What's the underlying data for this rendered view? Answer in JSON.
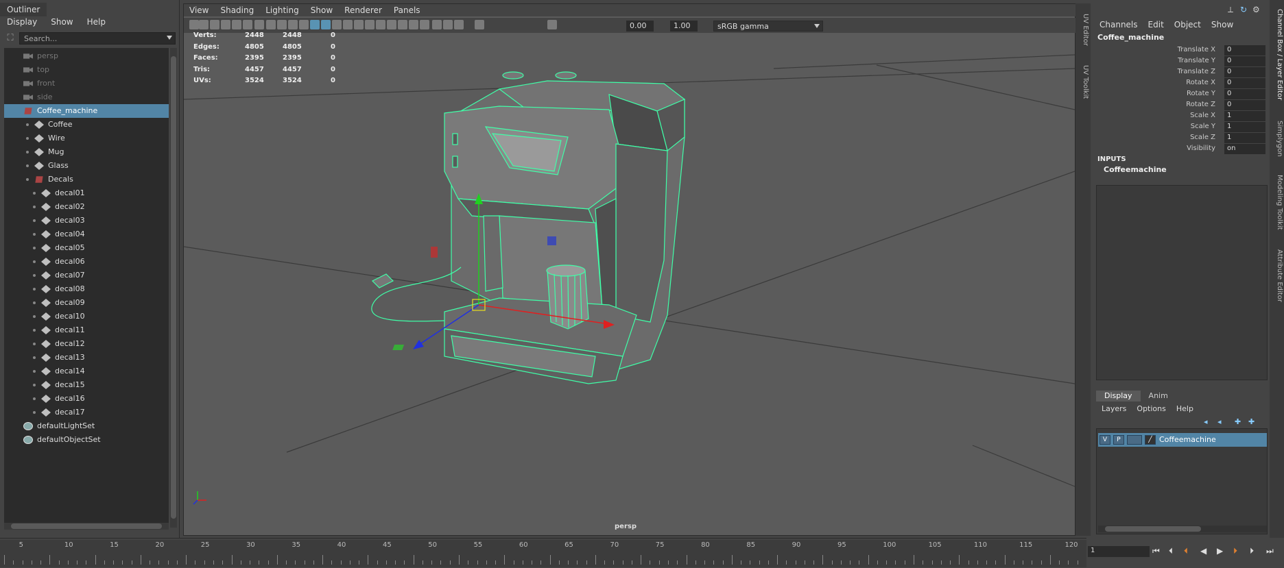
{
  "outliner": {
    "title": "Outliner",
    "menu": [
      "Display",
      "Show",
      "Help"
    ],
    "search_placeholder": "Search...",
    "items": [
      {
        "label": "persp",
        "kind": "camera",
        "dim": true
      },
      {
        "label": "top",
        "kind": "camera",
        "dim": true
      },
      {
        "label": "front",
        "kind": "camera",
        "dim": true
      },
      {
        "label": "side",
        "kind": "camera",
        "dim": true
      },
      {
        "label": "Coffee_machine",
        "kind": "transform",
        "selected": true
      },
      {
        "label": "Coffee",
        "kind": "mesh"
      },
      {
        "label": "Wire",
        "kind": "mesh"
      },
      {
        "label": "Mug",
        "kind": "mesh"
      },
      {
        "label": "Glass",
        "kind": "mesh"
      },
      {
        "label": "Decals",
        "kind": "transform"
      },
      {
        "label": "decal01",
        "kind": "mesh"
      },
      {
        "label": "decal02",
        "kind": "mesh"
      },
      {
        "label": "decal03",
        "kind": "mesh"
      },
      {
        "label": "decal04",
        "kind": "mesh"
      },
      {
        "label": "decal05",
        "kind": "mesh"
      },
      {
        "label": "decal06",
        "kind": "mesh"
      },
      {
        "label": "decal07",
        "kind": "mesh"
      },
      {
        "label": "decal08",
        "kind": "mesh"
      },
      {
        "label": "decal09",
        "kind": "mesh"
      },
      {
        "label": "decal10",
        "kind": "mesh"
      },
      {
        "label": "decal11",
        "kind": "mesh"
      },
      {
        "label": "decal12",
        "kind": "mesh"
      },
      {
        "label": "decal13",
        "kind": "mesh"
      },
      {
        "label": "decal14",
        "kind": "mesh"
      },
      {
        "label": "decal15",
        "kind": "mesh"
      },
      {
        "label": "decal16",
        "kind": "mesh"
      },
      {
        "label": "decal17",
        "kind": "mesh"
      },
      {
        "label": "defaultLightSet",
        "kind": "set"
      },
      {
        "label": "defaultObjectSet",
        "kind": "set"
      }
    ]
  },
  "viewport": {
    "menu": [
      "View",
      "Shading",
      "Lighting",
      "Show",
      "Renderer",
      "Panels"
    ],
    "exposure": "0.00",
    "gamma": "1.00",
    "color_space": "sRGB gamma",
    "camera_label": "persp",
    "hud": [
      {
        "label": "Verts:",
        "a": "2448",
        "b": "2448",
        "c": "0"
      },
      {
        "label": "Edges:",
        "a": "4805",
        "b": "4805",
        "c": "0"
      },
      {
        "label": "Faces:",
        "a": "2395",
        "b": "2395",
        "c": "0"
      },
      {
        "label": "Tris:",
        "a": "4457",
        "b": "4457",
        "c": "0"
      },
      {
        "label": "UVs:",
        "a": "3524",
        "b": "3524",
        "c": "0"
      }
    ]
  },
  "side_tabs_left": [
    "UV Editor",
    "UV Toolkit"
  ],
  "side_tabs_right": [
    "Channel Box / Layer Editor",
    "Simplygon",
    "Modeling Toolkit",
    "Attribute Editor"
  ],
  "channel_box": {
    "menu": [
      "Channels",
      "Edit",
      "Object",
      "Show"
    ],
    "object_name": "Coffee_machine",
    "attributes": [
      {
        "label": "Translate X",
        "value": "0"
      },
      {
        "label": "Translate Y",
        "value": "0"
      },
      {
        "label": "Translate Z",
        "value": "0"
      },
      {
        "label": "Rotate X",
        "value": "0"
      },
      {
        "label": "Rotate Y",
        "value": "0"
      },
      {
        "label": "Rotate Z",
        "value": "0"
      },
      {
        "label": "Scale X",
        "value": "1"
      },
      {
        "label": "Scale Y",
        "value": "1"
      },
      {
        "label": "Scale Z",
        "value": "1"
      },
      {
        "label": "Visibility",
        "value": "on"
      }
    ],
    "inputs_header": "INPUTS",
    "inputs_item": "Coffeemachine"
  },
  "layer_editor": {
    "tabs": [
      "Display",
      "Anim"
    ],
    "menu": [
      "Layers",
      "Options",
      "Help"
    ],
    "layer": {
      "v": "V",
      "p": "P",
      "name": "Coffeemachine"
    }
  },
  "timeline": {
    "ticks": [
      "5",
      "10",
      "15",
      "20",
      "25",
      "30",
      "35",
      "40",
      "45",
      "50",
      "55",
      "60",
      "65",
      "70",
      "75",
      "80",
      "85",
      "90",
      "95",
      "100",
      "105",
      "110",
      "115",
      "120"
    ],
    "current_frame": "1"
  },
  "colors": {
    "wire": "#3fffa8",
    "selected": "#5285a6",
    "axis_x": "#e02020",
    "axis_y": "#20d020",
    "axis_z": "#2030e0"
  }
}
